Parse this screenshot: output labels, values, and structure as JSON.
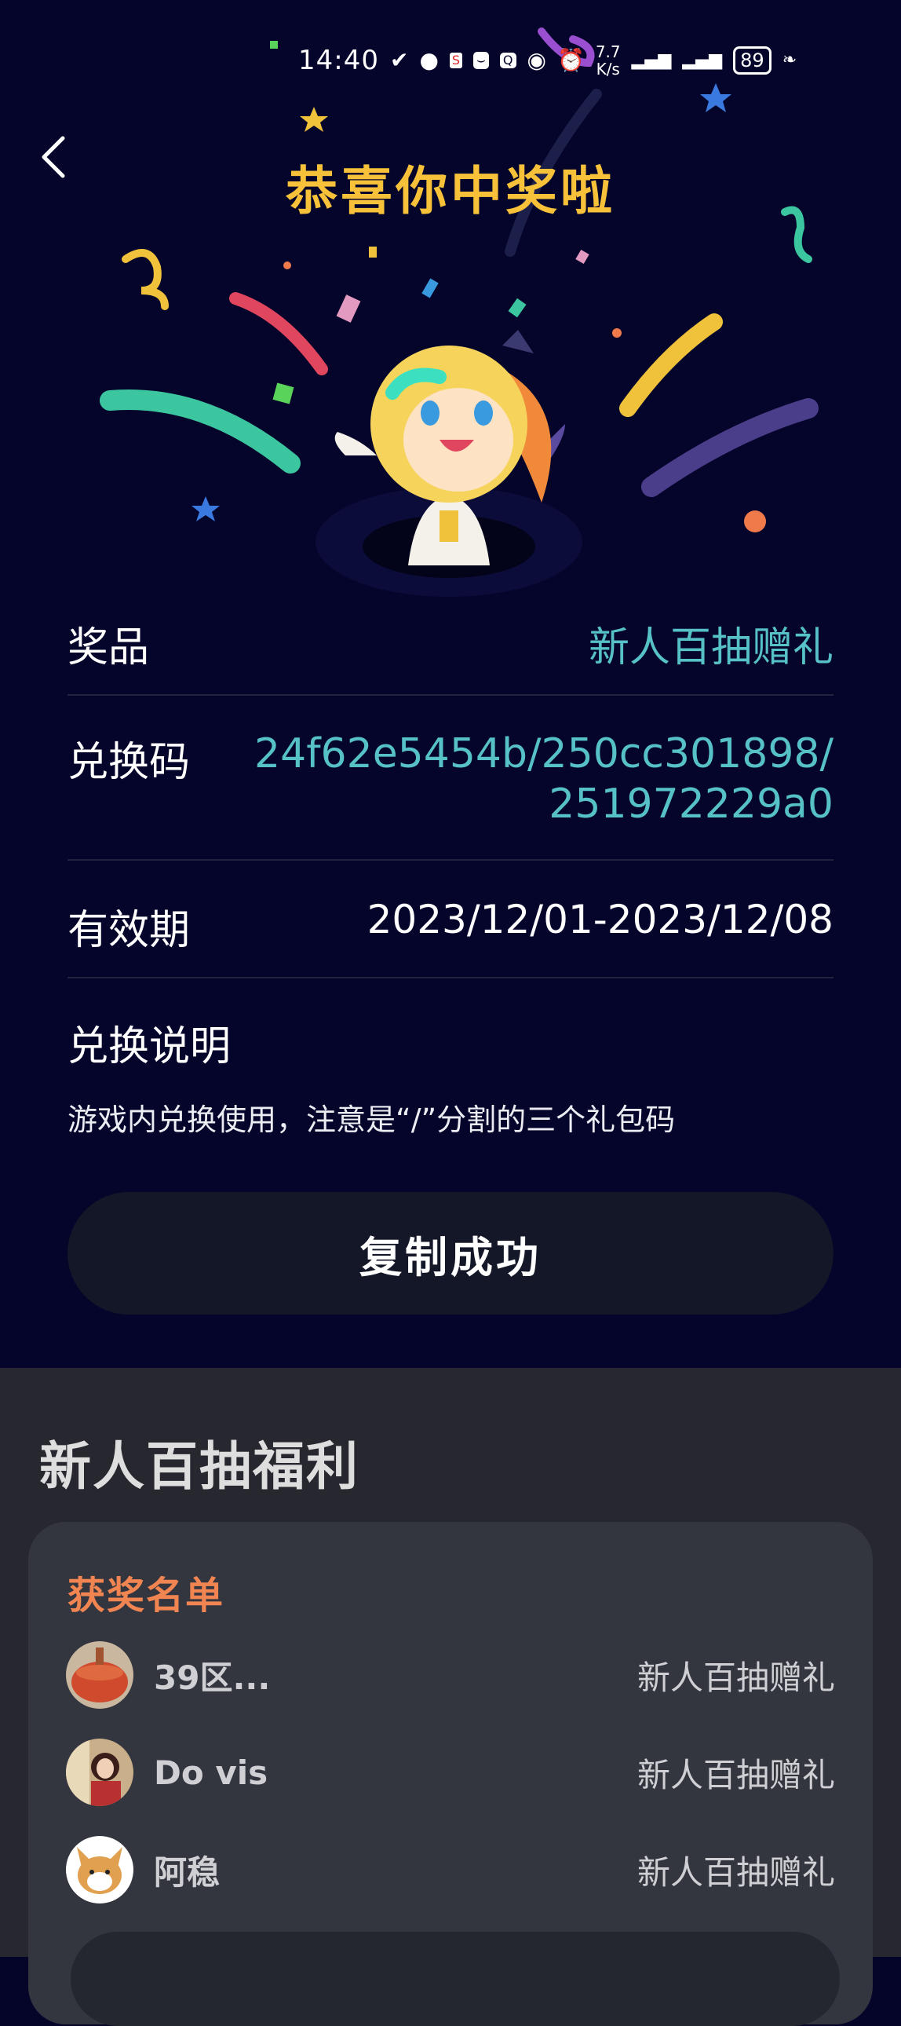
{
  "status_bar": {
    "time": "14:40",
    "net_speed_value": "7.7",
    "net_speed_unit": "K/s",
    "battery": "89",
    "icons": [
      "signal-hook-icon",
      "wechat-icon",
      "sina-icon",
      "shopping-bag-icon",
      "qq-icon",
      "eye-icon",
      "alarm-icon",
      "4g-signal-icon",
      "4g-signal-icon",
      "leaf-icon"
    ]
  },
  "header": {
    "title": "恭喜你中奖啦",
    "back_icon": "chevron-left-icon"
  },
  "details": {
    "prize_label": "奖品",
    "prize_value": "新人百抽赠礼",
    "code_label": "兑换码",
    "code_line1": "24f62e5454b/250cc301898/",
    "code_line2": "251972229a0",
    "validity_label": "有效期",
    "validity_value": "2023/12/01-2023/12/08",
    "instructions_label": "兑换说明",
    "instructions_text": "游戏内兑换使用，注意是“/”分割的三个礼包码"
  },
  "copy_button": {
    "label": "复制成功"
  },
  "welfare": {
    "title": "新人百抽福利",
    "winners_title": "获奖名单",
    "winners": [
      {
        "name": "39区...",
        "prize": "新人百抽赠礼"
      },
      {
        "name": "Do vis",
        "prize": "新人百抽赠礼"
      },
      {
        "name": "阿稳",
        "prize": "新人百抽赠礼"
      }
    ]
  },
  "colors": {
    "accent_gold": "#f7c23a",
    "accent_cyan": "#56c1c6",
    "winners_orange": "#f08552",
    "background": "#05042b"
  }
}
